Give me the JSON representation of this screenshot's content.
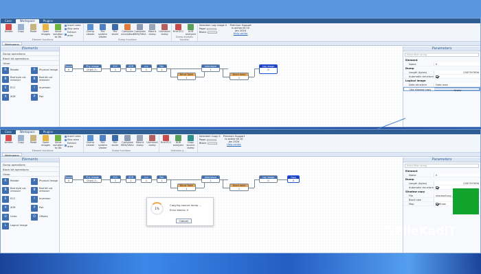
{
  "app": {
    "tabs": [
      "Case",
      "Workspace",
      "Plugins"
    ],
    "active_tab": "Workspace",
    "workspace_tab": "Workspace"
  },
  "ribbon": {
    "buttons": [
      "Delete",
      "Copy",
      "Paste",
      "Open images",
      "Send solution to Db",
      "Dump viewer",
      "File system viewer",
      "File saver",
      "Compute accelation",
      "Compute MD5/SHA1",
      "Mount dump",
      "Unmount dump",
      "Find ECC",
      "XOR analyzer",
      "Copy source dump"
    ],
    "insert_items": [
      "Insert area",
      "Skip area",
      "Extract area"
    ],
    "group_captions": [
      "Element functions",
      "Dump functions",
      "Dump analysis function",
      "Selection p..."
    ],
    "select_label": "Selected: Log image 0",
    "select_label_2": "Selected: Copy 0",
    "page_label": "Page:",
    "block_label": "Block:",
    "support_text": "Premium Support is active till 10 Jan 2024",
    "help_link": "Help center"
  },
  "elements_pane": {
    "title": "Elements",
    "categories": [
      "Dump operations",
      "Block bit operations",
      "Other"
    ],
    "items": [
      {
        "label": "Reader",
        "icon": "reader-icon",
        "glyph": "R"
      },
      {
        "label": "Physical image",
        "icon": "physical-image-icon",
        "glyph": "P"
      },
      {
        "label": "Bad byte col. remover",
        "icon": "bad-byte-icon",
        "glyph": "B"
      },
      {
        "label": "Bad bit col. remover",
        "icon": "bad-bit-icon",
        "glyph": "B"
      },
      {
        "label": "ECC",
        "icon": "ecc-icon",
        "glyph": "E"
      },
      {
        "label": "Inversion",
        "icon": "inversion-icon",
        "glyph": "I"
      },
      {
        "label": "XOR",
        "icon": "xor-icon",
        "glyph": "X"
      },
      {
        "label": "Pair",
        "icon": "pair-icon",
        "glyph": "P"
      }
    ],
    "items_extra": [
      {
        "label": "Unite",
        "icon": "unite-icon",
        "glyph": "U"
      },
      {
        "label": "Offsets",
        "icon": "offsets-icon",
        "glyph": "O"
      },
      {
        "label": "Logical image",
        "icon": "logical-image-icon",
        "glyph": "L"
      }
    ]
  },
  "graph1": {
    "nodes": [
      {
        "title": "Reader",
        "value": "0"
      },
      {
        "title": "Phy. image",
        "value": "Chip0_0..."
      },
      {
        "title": "ECC",
        "value": "1"
      },
      {
        "title": "XOR",
        "value": "1"
      },
      {
        "title": "Inv",
        "value": "1"
      },
      {
        "title": "Pair",
        "value": "1"
      },
      {
        "title": "Interleave",
        "value": "1"
      },
      {
        "title": "Bitrot Table",
        "value": "1"
      },
      {
        "title": "Unite",
        "value": "1"
      },
      {
        "title": "Block table",
        "value": "1"
      },
      {
        "title": "Log image",
        "value": "0"
      }
    ]
  },
  "graph2": {
    "extra_node": {
      "title": "Copy",
      "value": "0"
    }
  },
  "progress_dialog": {
    "percent": "1%",
    "message": "Copying source dump ...",
    "errors": "Error blocks: 0",
    "cancel": "Cancel"
  },
  "params1": {
    "title": "Parameters",
    "filter_placeholder": "Enter filter string",
    "sections": {
      "element": "Element",
      "dump": "Dump",
      "logical": "Logical image"
    },
    "rows": [
      {
        "k": "Name",
        "v": "0"
      },
      {
        "k": "Length (bytes)",
        "v": "2387397696"
      },
      {
        "k": "Automatic structure",
        "v": ""
      },
      {
        "k": "Data structure",
        "v": "Data area"
      },
      {
        "k": "Use shadow copy",
        "v": "Apply"
      }
    ]
  },
  "params2": {
    "title": "Parameters",
    "filter_placeholder": "Enter filter string",
    "sections": {
      "element": "Element",
      "dump": "Dump",
      "shadow": "Shadow copy"
    },
    "rows": [
      {
        "k": "Name",
        "v": "0"
      },
      {
        "k": "Length (bytes)",
        "v": "2387397696"
      },
      {
        "k": "Automatic structure",
        "v": ""
      },
      {
        "k": "File",
        "v": "shadowCopy_0_00.dmp"
      },
      {
        "k": "Block size",
        "v": "524288"
      },
      {
        "k": "Map",
        "v": "Show"
      }
    ]
  },
  "watermark": {
    "text": "FileKadiT"
  },
  "colors": {
    "accent": "#2f5e94",
    "orange_node": "#e9a85a",
    "map_green": "#11a32c"
  }
}
